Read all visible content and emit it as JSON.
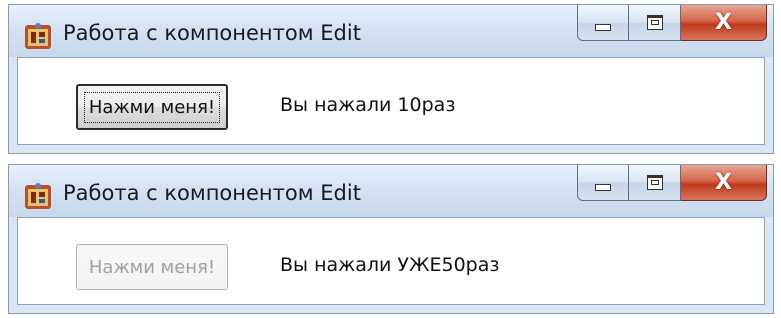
{
  "windows": [
    {
      "title": "Работа с компонентом Edit",
      "icon": "app-icon",
      "caption_buttons": {
        "minimize": "minimize-icon",
        "maximize": "maximize-icon",
        "close": "X"
      },
      "button": {
        "label": "Нажми меня!",
        "state": "focused"
      },
      "label": "Вы нажали 10раз"
    },
    {
      "title": "Работа с компонентом Edit",
      "icon": "app-icon",
      "caption_buttons": {
        "minimize": "minimize-icon",
        "maximize": "maximize-icon",
        "close": "X"
      },
      "button": {
        "label": "Нажми меня!",
        "state": "disabled"
      },
      "label": "Вы нажали УЖЕ50раз"
    }
  ],
  "colors": {
    "titlebar": "#d4e2f3",
    "close_button": "#c0391d",
    "window_border": "#7f9db9"
  }
}
